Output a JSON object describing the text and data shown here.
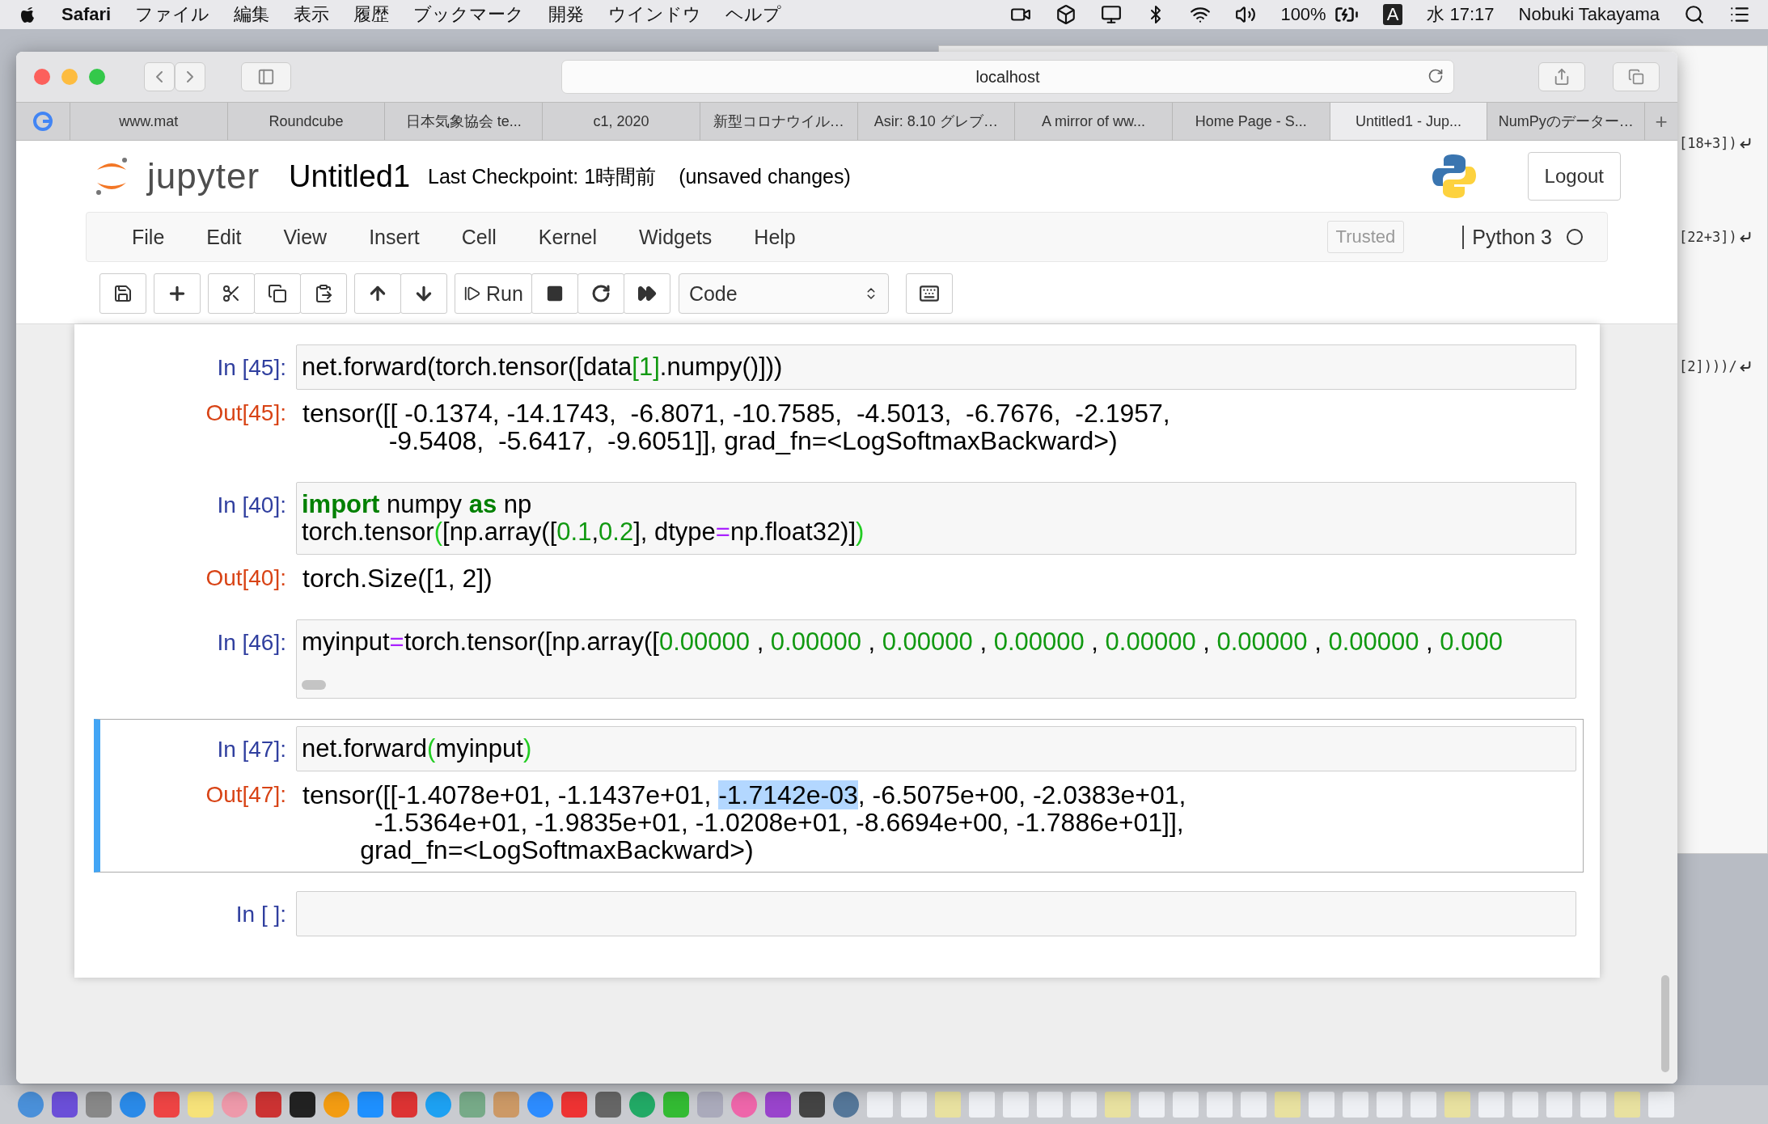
{
  "menu_bar": {
    "app": "Safari",
    "menus": [
      "ファイル",
      "編集",
      "表示",
      "履歴",
      "ブックマーク",
      "開発",
      "ウインドウ",
      "ヘルプ"
    ],
    "battery": "100%",
    "input_source": "A",
    "clock": "水 17:17",
    "user": "Nobuki Takayama"
  },
  "browser": {
    "address": "localhost",
    "tabs": [
      {
        "label": "www.mat",
        "selected": false
      },
      {
        "label": "Roundcube",
        "selected": false
      },
      {
        "label": "日本気象協会 te...",
        "selected": false
      },
      {
        "label": "c1, 2020",
        "selected": false
      },
      {
        "label": "新型コロナウイル…",
        "selected": false
      },
      {
        "label": "Asir: 8.10 グレブ…",
        "selected": false
      },
      {
        "label": "A mirror of ww...",
        "selected": false
      },
      {
        "label": "Home Page - S...",
        "selected": false
      },
      {
        "label": "Untitled1 - Jup...",
        "selected": true
      },
      {
        "label": "NumPyのデーター…",
        "selected": false
      }
    ],
    "new_tab": "+"
  },
  "notebook": {
    "logo": "jupyter",
    "title": "Untitled1",
    "checkpoint": "Last Checkpoint: 1時間前",
    "status": "(unsaved changes)",
    "logout": "Logout",
    "menus": [
      "File",
      "Edit",
      "View",
      "Insert",
      "Cell",
      "Kernel",
      "Widgets",
      "Help"
    ],
    "trusted": "Trusted",
    "kernel": "Python 3",
    "run": "Run",
    "cell_type": "Code"
  },
  "cells": [
    {
      "prompt": "In [45]:",
      "selected": false,
      "scrollbar": false,
      "input": [
        [
          {
            "text": "net.forward(torch.tensor([data",
            "kind": "plain"
          },
          {
            "text": "[1]",
            "kind": "number"
          },
          {
            "text": ".numpy()]))",
            "kind": "plain"
          }
        ]
      ],
      "output": {
        "prompt": "Out[45]:",
        "lines": [
          [
            {
              "text": "tensor([[ -0.1374, -14.1743,  -6.8071, -10.7585,  -4.5013,  -6.7676,  -2.1957,",
              "selected": false
            }
          ],
          [
            {
              "text": "            -9.5408,  -5.6417,  -9.6051]], grad_fn=<LogSoftmaxBackward>)",
              "selected": false
            }
          ]
        ]
      }
    },
    {
      "prompt": "In [40]:",
      "selected": false,
      "scrollbar": false,
      "input": [
        [
          {
            "text": "import",
            "kind": "keyword"
          },
          {
            "text": " numpy ",
            "kind": "plain"
          },
          {
            "text": "as",
            "kind": "keyword"
          },
          {
            "text": " np",
            "kind": "plain"
          }
        ],
        [
          {
            "text": "torch.tensor",
            "kind": "plain"
          },
          {
            "text": "(",
            "kind": "bracket"
          },
          {
            "text": "[np.array([",
            "kind": "plain"
          },
          {
            "text": "0.1",
            "kind": "number"
          },
          {
            "text": ",",
            "kind": "plain"
          },
          {
            "text": "0.2",
            "kind": "number"
          },
          {
            "text": "], dtype",
            "kind": "plain"
          },
          {
            "text": "=",
            "kind": "operator"
          },
          {
            "text": "np.float32)]",
            "kind": "plain"
          },
          {
            "text": ")",
            "kind": "bracket"
          }
        ]
      ],
      "output": {
        "prompt": "Out[40]:",
        "lines": [
          [
            {
              "text": "torch.Size([1, 2])",
              "selected": false
            }
          ]
        ]
      }
    },
    {
      "prompt": "In [46]:",
      "selected": false,
      "scrollbar": true,
      "input": [
        [
          {
            "text": "myinput",
            "kind": "plain"
          },
          {
            "text": "=",
            "kind": "operator"
          },
          {
            "text": "torch.tensor([np.array([",
            "kind": "plain"
          },
          {
            "text": "0.00000",
            "kind": "number"
          },
          {
            "text": " , ",
            "kind": "plain"
          },
          {
            "text": "0.00000",
            "kind": "number"
          },
          {
            "text": " , ",
            "kind": "plain"
          },
          {
            "text": "0.00000",
            "kind": "number"
          },
          {
            "text": " , ",
            "kind": "plain"
          },
          {
            "text": "0.00000",
            "kind": "number"
          },
          {
            "text": " , ",
            "kind": "plain"
          },
          {
            "text": "0.00000",
            "kind": "number"
          },
          {
            "text": " , ",
            "kind": "plain"
          },
          {
            "text": "0.00000",
            "kind": "number"
          },
          {
            "text": " , ",
            "kind": "plain"
          },
          {
            "text": "0.00000",
            "kind": "number"
          },
          {
            "text": " , ",
            "kind": "plain"
          },
          {
            "text": "0.000",
            "kind": "number"
          }
        ]
      ]
    },
    {
      "prompt": "In [47]:",
      "selected": true,
      "scrollbar": false,
      "input": [
        [
          {
            "text": "net.forward",
            "kind": "plain"
          },
          {
            "text": "(",
            "kind": "bracket"
          },
          {
            "text": "myinput",
            "kind": "plain"
          },
          {
            "text": ")",
            "kind": "bracket"
          }
        ]
      ],
      "output": {
        "prompt": "Out[47]:",
        "lines": [
          [
            {
              "text": "tensor([[-1.4078e+01, -1.1437e+01, ",
              "selected": false
            },
            {
              "text": "-1.7142e-03",
              "selected": true
            },
            {
              "text": ", -6.5075e+00, -2.0383e+01,",
              "selected": false
            }
          ],
          [
            {
              "text": "          -1.5364e+01, -1.9835e+01, -1.0208e+01, -8.6694e+00, -1.7886e+01]],",
              "selected": false
            }
          ],
          [
            {
              "text": "        grad_fn=<LogSoftmaxBackward>)",
              "selected": false
            }
          ]
        ]
      }
    },
    {
      "prompt": "In [ ]:",
      "selected": false,
      "scrollbar": false
    }
  ],
  "terminal": {
    "lines": [
      "[18+3])",
      "[22+3])",
      "[2])))/"
    ]
  }
}
